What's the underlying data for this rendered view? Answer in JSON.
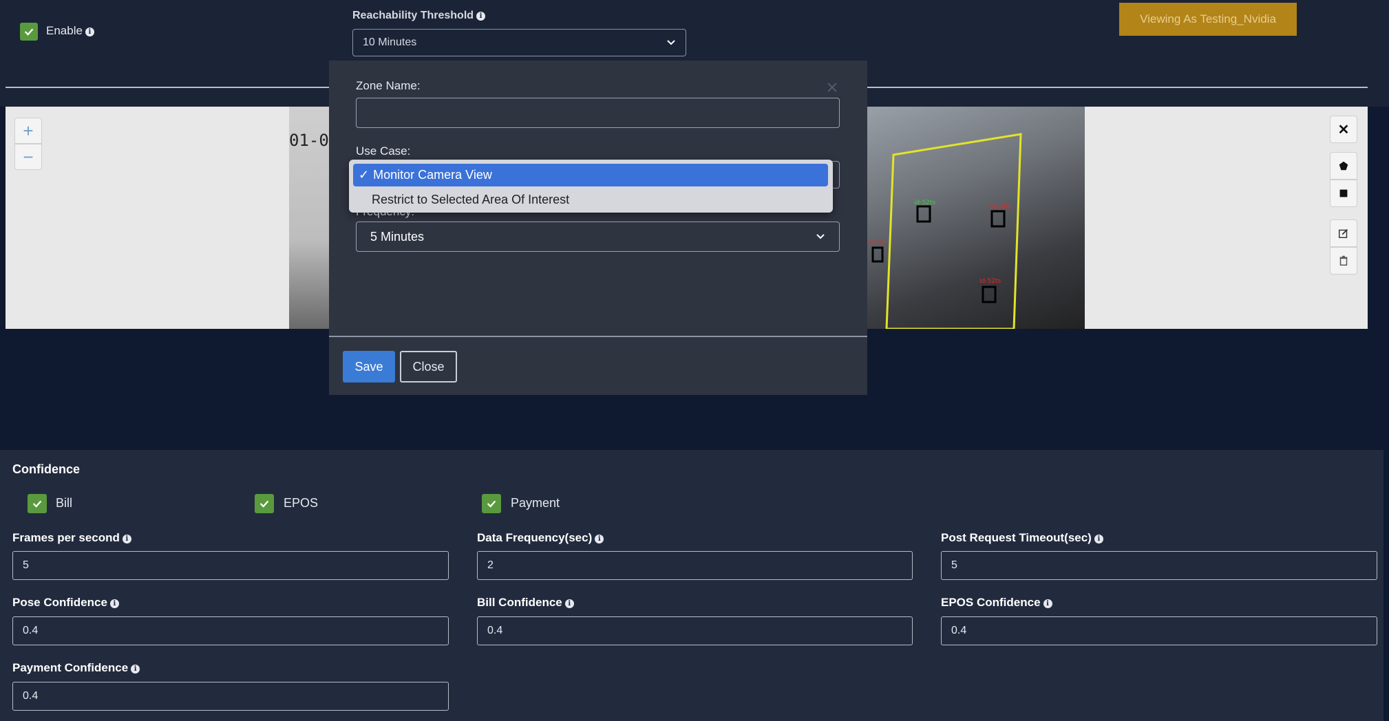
{
  "header": {
    "enable_label": "Enable",
    "reachability_label": "Reachability Threshold",
    "reachability_value": "10 Minutes",
    "viewing_badge": "Viewing As Testing_Nvidia"
  },
  "camera": {
    "date_fragment": "01-0",
    "zoom_in": "+",
    "zoom_out": "−",
    "close_glyph": "✕"
  },
  "modal": {
    "zone_name_label": "Zone Name:",
    "zone_name_value": "",
    "use_case_label": "Use Case:",
    "use_case_options": [
      "Monitor Camera View",
      "Restrict to Selected Area Of Interest"
    ],
    "use_case_selected": "Monitor Camera View",
    "frequency_label": "Frequency:",
    "frequency_value": "5 Minutes",
    "save_label": "Save",
    "close_label": "Close"
  },
  "form": {
    "confidence_title": "Confidence",
    "checkboxes": [
      "Bill",
      "EPOS",
      "Payment"
    ],
    "fields": {
      "fps_label": "Frames per second",
      "fps_value": "5",
      "data_freq_label": "Data Frequency(sec)",
      "data_freq_value": "2",
      "post_timeout_label": "Post Request Timeout(sec)",
      "post_timeout_value": "5",
      "pose_conf_label": "Pose Confidence",
      "pose_conf_value": "0.4",
      "bill_conf_label": "Bill Confidence",
      "bill_conf_value": "0.4",
      "epos_conf_label": "EPOS Confidence",
      "epos_conf_value": "0.4",
      "payment_conf_label": "Payment Confidence",
      "payment_conf_value": "0.4"
    }
  },
  "colors": {
    "page_bg": "#0f1930",
    "panel_bg": "#222b3e",
    "modal_bg": "#2f3441",
    "checkbox_green": "#5a9a3e",
    "primary_blue": "#3a7bd5",
    "badge_gold": "#b38418"
  }
}
